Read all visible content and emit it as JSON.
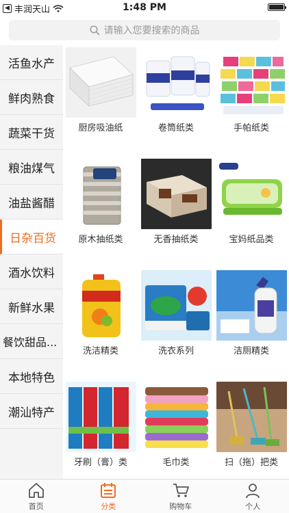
{
  "status": {
    "carrier": "丰润天山",
    "time": "1:48 PM"
  },
  "search": {
    "placeholder": "请输入您要搜索的商品"
  },
  "sidebar": {
    "items": [
      {
        "label": "活鱼水产"
      },
      {
        "label": "鲜肉熟食"
      },
      {
        "label": "蔬菜干货"
      },
      {
        "label": "粮油煤气"
      },
      {
        "label": "油盐酱醋"
      },
      {
        "label": "日杂百货"
      },
      {
        "label": "酒水饮料"
      },
      {
        "label": "新鲜水果"
      },
      {
        "label": "餐饮甜品..."
      },
      {
        "label": "本地特色"
      },
      {
        "label": "潮汕特产"
      }
    ],
    "active": "日杂百货"
  },
  "products": [
    {
      "label": "厨房吸油纸"
    },
    {
      "label": "卷筒纸类"
    },
    {
      "label": "手帕纸类"
    },
    {
      "label": "原木抽纸类"
    },
    {
      "label": "无香抽纸类"
    },
    {
      "label": "宝妈纸品类"
    },
    {
      "label": "洗洁精类"
    },
    {
      "label": "洗衣系列"
    },
    {
      "label": "洁厕精类"
    },
    {
      "label": "牙刷（膏）类"
    },
    {
      "label": "毛巾类"
    },
    {
      "label": "扫（拖）把类"
    }
  ],
  "tabs": [
    {
      "label": "首页",
      "icon": "home-icon"
    },
    {
      "label": "分类",
      "icon": "category-icon"
    },
    {
      "label": "购物车",
      "icon": "cart-icon"
    },
    {
      "label": "个人",
      "icon": "person-icon"
    }
  ],
  "colors": {
    "accent": "#f26b1d"
  }
}
